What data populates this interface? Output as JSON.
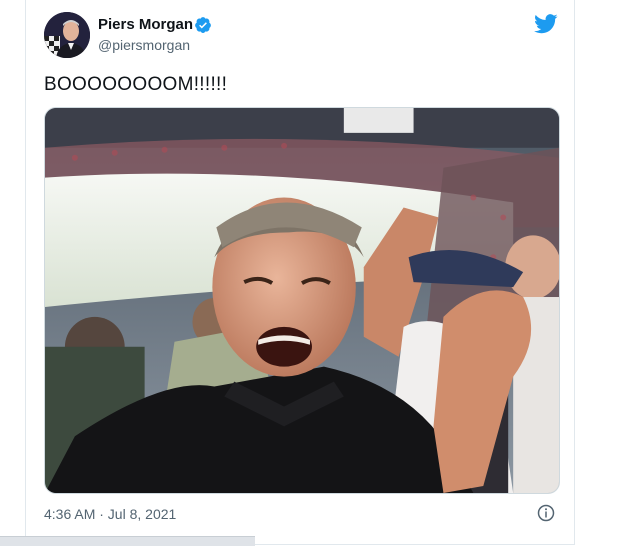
{
  "tweet": {
    "display_name": "Piers Morgan",
    "handle": "@piersmorgan",
    "text": "BOOOOOOOOM!!!!!!",
    "timestamp": "4:36 AM · Jul 8, 2021",
    "verified": true
  },
  "icons": {
    "verified": "verified-badge-icon",
    "logo": "twitter-bird-icon",
    "info": "info-icon"
  },
  "colors": {
    "brand_blue": "#1d9bf0",
    "secondary_text": "#536471",
    "border": "#e1e8ed"
  }
}
